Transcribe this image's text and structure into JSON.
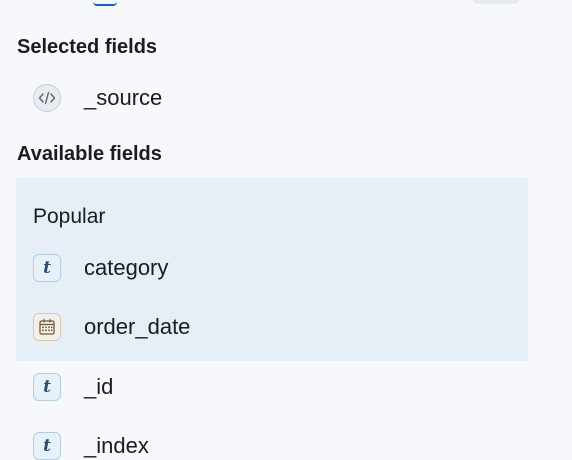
{
  "selected_fields": {
    "title": "Selected fields",
    "items": [
      {
        "name": "_source",
        "type_icon": "code-icon"
      }
    ]
  },
  "available_fields": {
    "title": "Available fields",
    "popular": {
      "label": "Popular",
      "items": [
        {
          "name": "category",
          "type_icon": "text-type-icon"
        },
        {
          "name": "order_date",
          "type_icon": "calendar-icon"
        }
      ]
    },
    "items": [
      {
        "name": "_id",
        "type_icon": "text-type-icon"
      },
      {
        "name": "_index",
        "type_icon": "text-type-icon"
      }
    ]
  },
  "type_glyphs": {
    "text": "t"
  },
  "colors": {
    "background": "#f7f8fc",
    "popular_background": "#e6eef6",
    "text_icon_background": "#e6f1fa",
    "date_icon_background": "#f5efe6",
    "text": "#1a1c21"
  }
}
